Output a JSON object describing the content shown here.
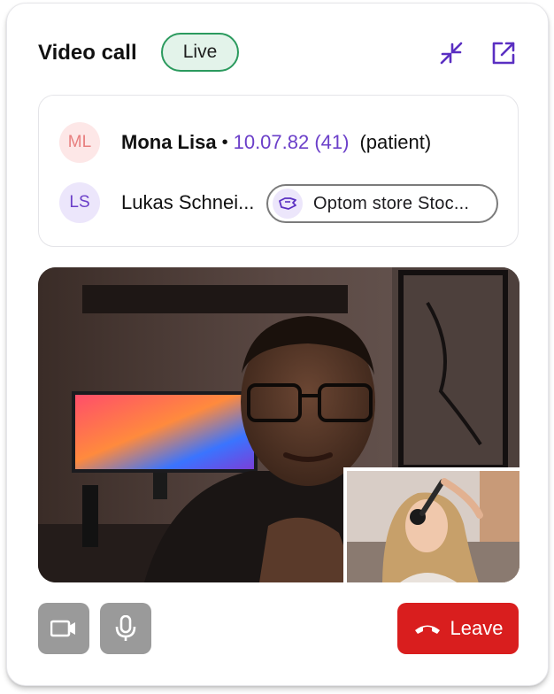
{
  "header": {
    "title": "Video call",
    "status_badge": "Live",
    "collapse_icon": "collapse-arrows-icon",
    "popout_icon": "open-in-new-icon"
  },
  "participants": {
    "patient": {
      "initials": "ML",
      "name": "Mona Lisa",
      "separator": "•",
      "dob": "10.07.82 (41)",
      "role": "(patient)"
    },
    "practitioner": {
      "initials": "LS",
      "name": "Lukas Schnei...",
      "store_icon": "store-icon",
      "store": "Optom store Stoc..."
    }
  },
  "controls": {
    "camera_icon": "camera-icon",
    "mic_icon": "microphone-icon",
    "leave_icon": "phone-hangup-icon",
    "leave_label": "Leave"
  },
  "colors": {
    "accent": "#6b3fc9",
    "live_border": "#2b9a5e",
    "live_bg": "#e3f3ea",
    "leave": "#d91e1e",
    "control_gray": "#9a9a9a"
  }
}
